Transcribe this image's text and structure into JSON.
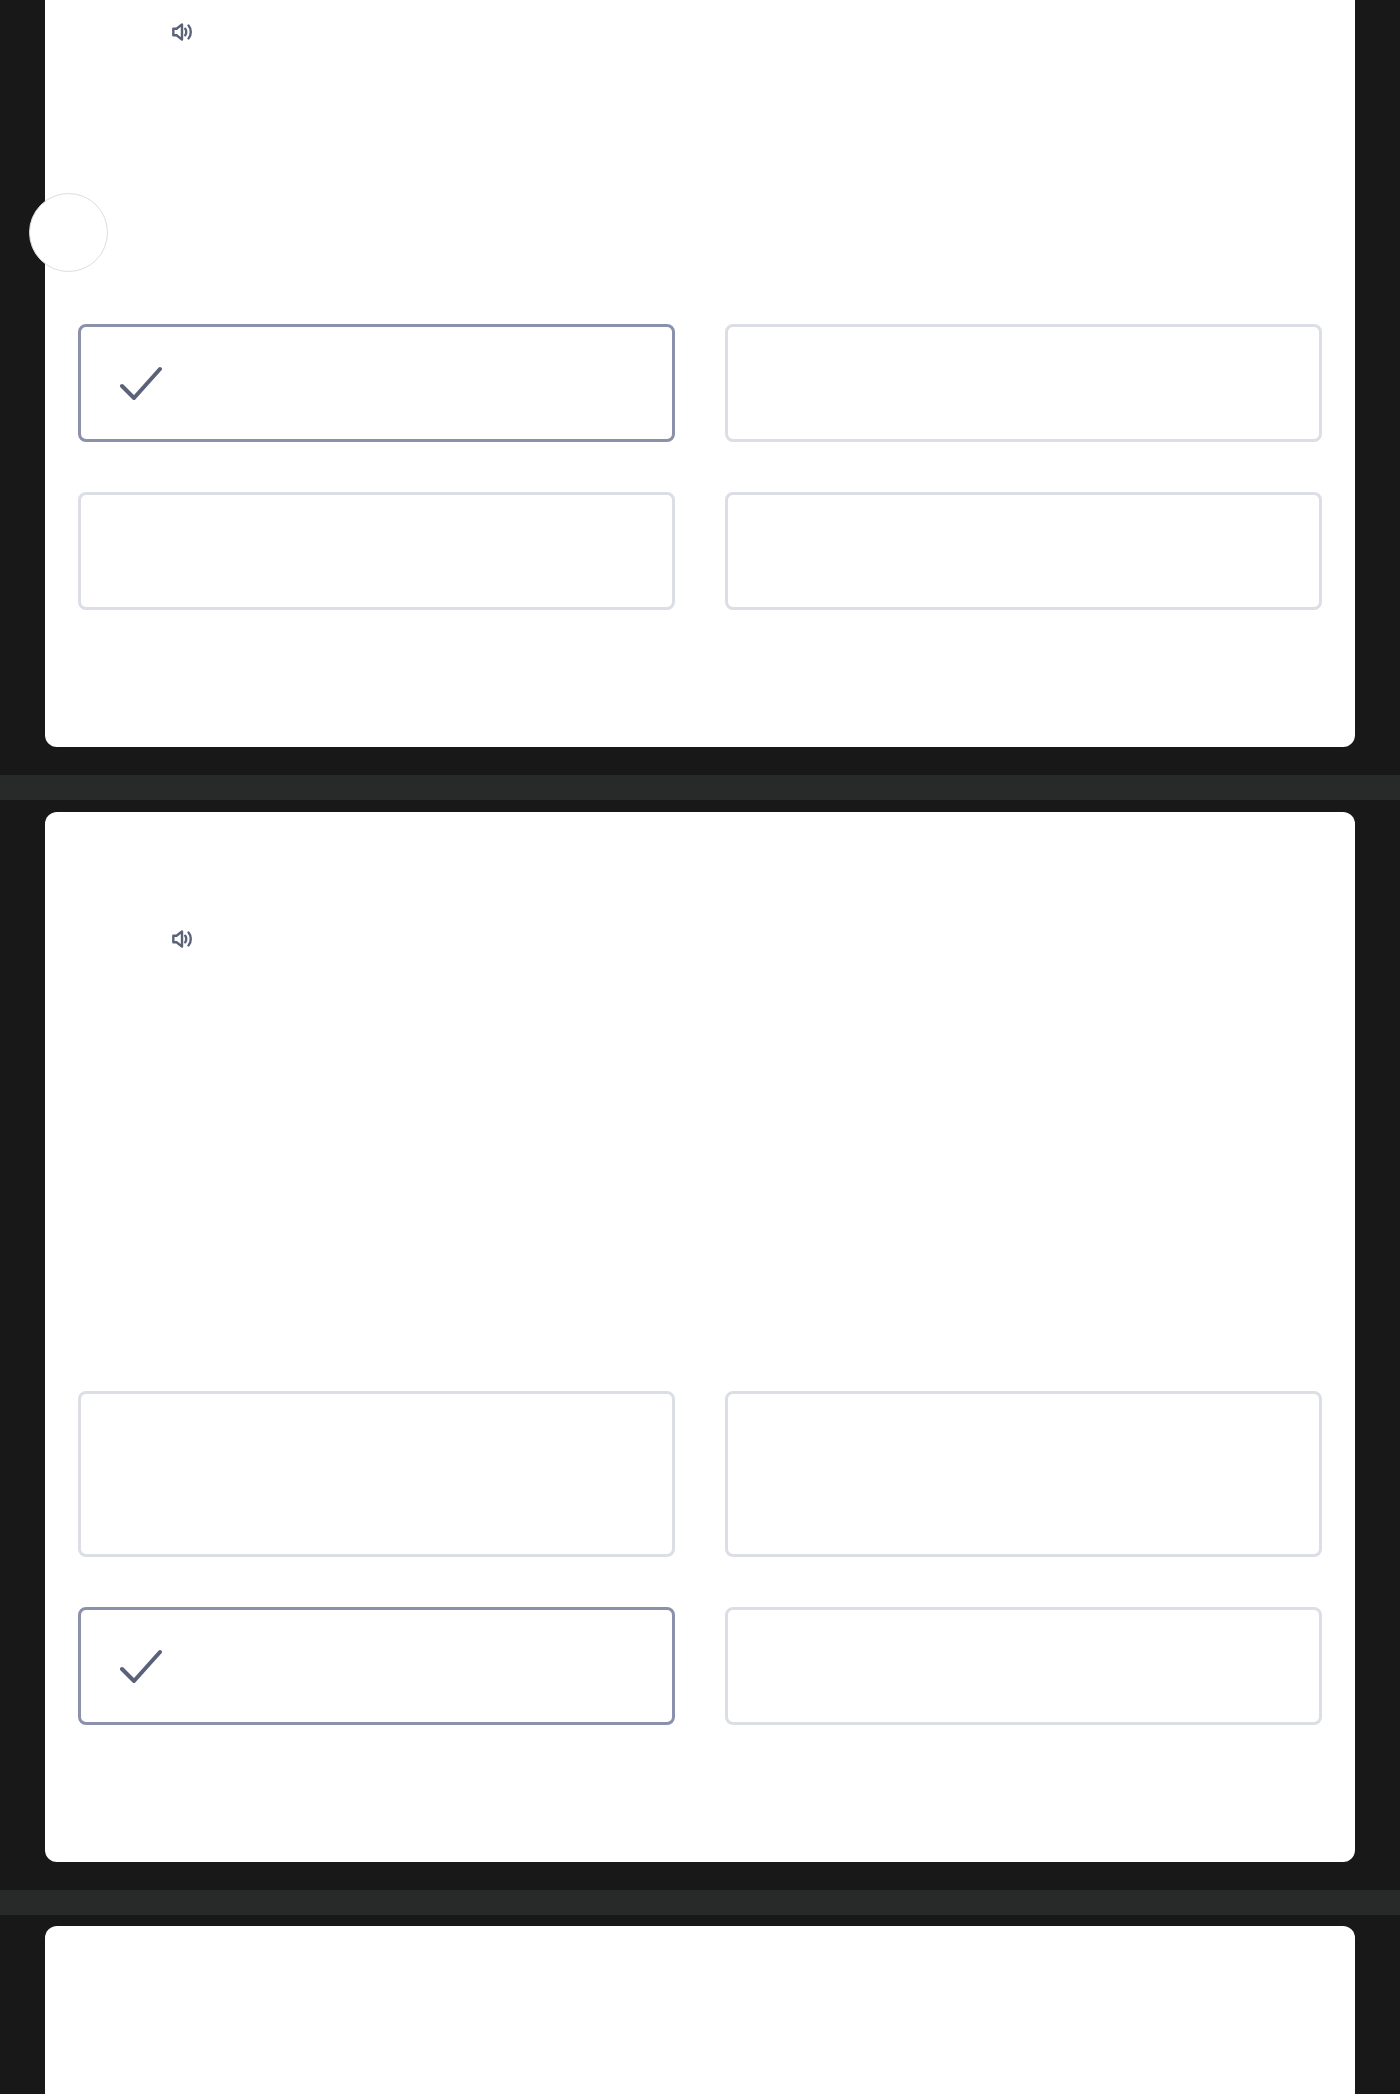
{
  "questions": [
    {
      "options": [
        {
          "selected": true
        },
        {
          "selected": false
        },
        {
          "selected": false
        },
        {
          "selected": false
        }
      ]
    },
    {
      "options": [
        {
          "selected": false
        },
        {
          "selected": false
        },
        {
          "selected": true
        },
        {
          "selected": false
        }
      ]
    }
  ]
}
